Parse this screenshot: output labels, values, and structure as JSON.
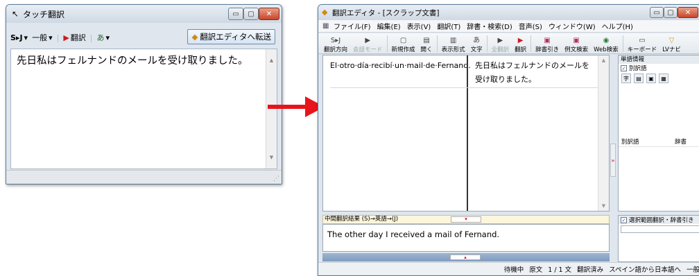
{
  "touch_window": {
    "title": "タッチ翻訳",
    "toolbar": {
      "direction_label": "S▸J",
      "category_label": "一般",
      "translate_label": "翻訳",
      "transfer_label": "翻訳エディタへ転送"
    },
    "text": "先日私はフェルナンドのメールを受け取りました。"
  },
  "editor_window": {
    "title": "翻訳エディタ - [スクラップ文書]",
    "menus": [
      "ファイル(F)",
      "編集(E)",
      "表示(V)",
      "翻訳(T)",
      "辞書・検索(D)",
      "音声(S)",
      "ウィンドウ(W)",
      "ヘルプ(H)"
    ],
    "tools": [
      {
        "icon": "S▸J",
        "label": "翻訳方向"
      },
      {
        "icon": "▶",
        "label": "会話モード"
      },
      {
        "icon": "▢",
        "label": "新規作成"
      },
      {
        "icon": "▤",
        "label": "開く"
      },
      {
        "icon": "▥",
        "label": "表示形式"
      },
      {
        "icon": "あ",
        "label": "文字"
      },
      {
        "icon": "▶",
        "label": "全翻訳"
      },
      {
        "icon": "▶",
        "label": "翻訳"
      },
      {
        "icon": "▣",
        "label": "辞書引き"
      },
      {
        "icon": "▣",
        "label": "例文検索"
      },
      {
        "icon": "◉",
        "label": "Web検索"
      },
      {
        "icon": "▭",
        "label": "キーボード"
      },
      {
        "icon": "▽",
        "label": "LVナビ"
      }
    ],
    "source_text": "El·otro·día·recibí·un·mail·de·Fernand.",
    "target_text": "先日私はフェルナンドのメールを受け取りました。",
    "side_panel": {
      "header": "単語情報",
      "alt_translations_check": "別訳語",
      "col_alt": "別訳語",
      "col_dict": "辞書"
    },
    "intermediate_label": "中間翻訳結果 (S)→英語→(J)",
    "intermediate_text": "The other day I received a mail of Fernand.",
    "bottom_panel_check": "選択範囲翻訳・辞書引き",
    "status": [
      "待機中",
      "原文",
      "1 / 1 文",
      "翻訳済み",
      "スペイン語から日本語へ",
      "一般"
    ]
  },
  "colors": {
    "arrow": "#e8141c",
    "accent_red": "#cc1a1a"
  }
}
